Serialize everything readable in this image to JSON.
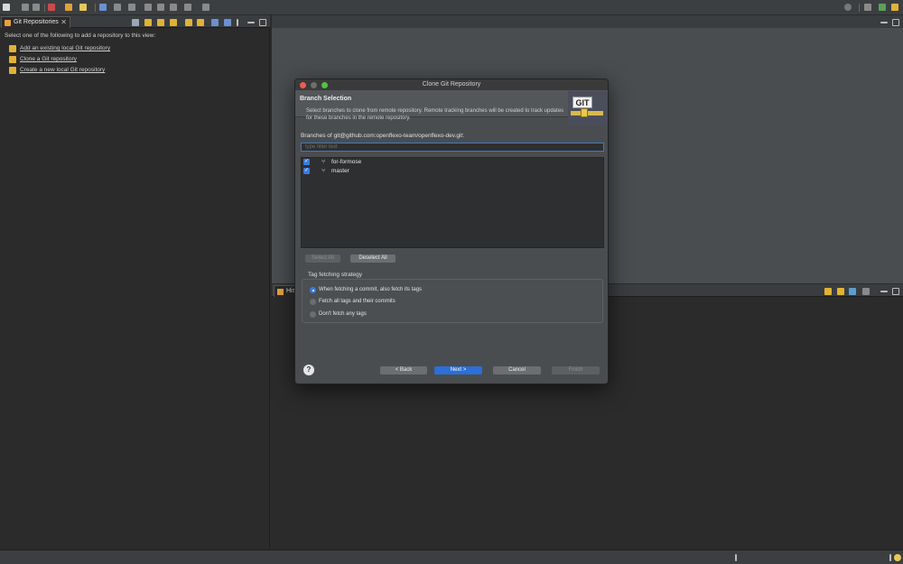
{
  "left_view": {
    "tab_label": "Git Repositories",
    "close_glyph": "✕",
    "message": "Select one of the following to add a repository to this view:",
    "links": [
      {
        "label": "Add an existing local Git repository",
        "icon": "add-repo-icon"
      },
      {
        "label": "Clone a Git repository",
        "icon": "clone-repo-icon"
      },
      {
        "label": "Create a new local Git repository",
        "icon": "create-repo-icon"
      }
    ]
  },
  "history_view": {
    "tab_label": "His"
  },
  "dialog": {
    "title": "Clone Git Repository",
    "header_title": "Branch Selection",
    "header_description": "Select branches to clone from remote repository. Remote tracking branches will be created to track updates for these branches in the remote repository.",
    "logo_text": "GIT",
    "branches_label": "Branches of git@github.com:openflexo-team/openflexo-dev.git:",
    "filter_placeholder": "type filter text",
    "branches": [
      {
        "name": "for-formose",
        "checked": true
      },
      {
        "name": "master",
        "checked": true
      }
    ],
    "select_all_label": "Select All",
    "deselect_all_label": "Deselect All",
    "tag_strategy_label": "Tag fetching strategy",
    "tag_options": [
      {
        "label": "When fetching a commit, also fetch its tags",
        "selected": true
      },
      {
        "label": "Fetch all tags and their commits",
        "selected": false
      },
      {
        "label": "Don't fetch any tags",
        "selected": false
      }
    ],
    "help_glyph": "?",
    "buttons": {
      "back": "< Back",
      "next": "Next >",
      "cancel": "Cancel",
      "finish": "Finish"
    }
  },
  "colors": {
    "accent": "#2c6fd8",
    "background": "#2b2b2b",
    "dialog": "#4a4d50"
  }
}
